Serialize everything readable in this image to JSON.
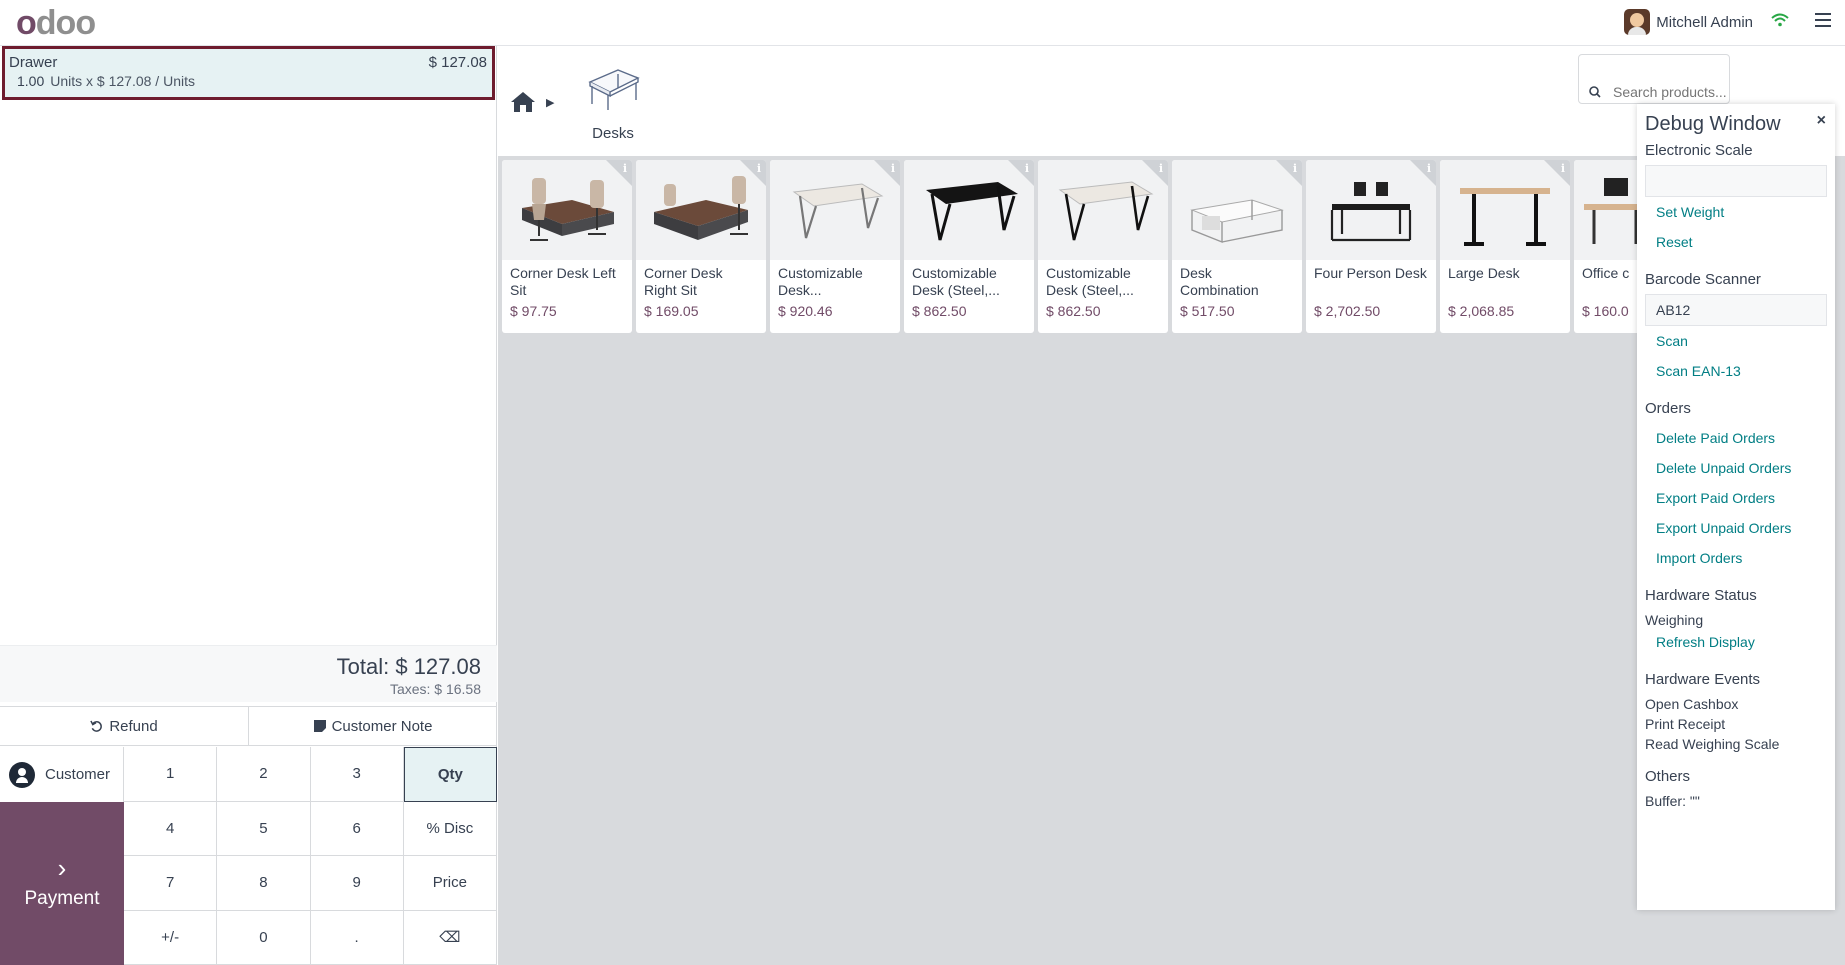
{
  "header": {
    "logo": "odoo",
    "user_name": "Mitchell Admin"
  },
  "order": {
    "line": {
      "product": "Drawer",
      "price": "$ 127.08",
      "qty": "1.00",
      "detail": "Units x $ 127.08 / Units"
    },
    "total": "Total: $ 127.08",
    "taxes": "Taxes: $ 16.58"
  },
  "actions": {
    "refund": "Refund",
    "customer_note": "Customer Note",
    "customer": "Customer",
    "payment": "Payment"
  },
  "numpad": [
    "1",
    "2",
    "3",
    "Qty",
    "4",
    "5",
    "6",
    "% Disc",
    "7",
    "8",
    "9",
    "Price",
    "+/-",
    "0",
    ".",
    "⌫"
  ],
  "categories": {
    "current": "Desks"
  },
  "search": {
    "placeholder": "Search products..."
  },
  "products": [
    {
      "name": "Corner Desk Left Sit",
      "price": "$ 97.75"
    },
    {
      "name": "Corner Desk Right Sit",
      "price": "$ 169.05"
    },
    {
      "name": "Customizable Desk...",
      "price": "$ 920.46"
    },
    {
      "name": "Customizable Desk (Steel,...",
      "price": "$ 862.50"
    },
    {
      "name": "Customizable Desk (Steel,...",
      "price": "$ 862.50"
    },
    {
      "name": "Desk Combination",
      "price": "$ 517.50"
    },
    {
      "name": "Four Person Desk",
      "price": "$ 2,702.50"
    },
    {
      "name": "Large Desk",
      "price": "$ 2,068.85"
    },
    {
      "name": "Office c",
      "price": "$ 160.0"
    }
  ],
  "debug": {
    "title": "Debug Window",
    "close": "×",
    "scale_title": "Electronic Scale",
    "set_weight": "Set Weight",
    "reset": "Reset",
    "barcode_title": "Barcode Scanner",
    "barcode_value": "AB12",
    "scan": "Scan",
    "scan_ean": "Scan EAN-13",
    "orders_title": "Orders",
    "delete_paid": "Delete Paid Orders",
    "delete_unpaid": "Delete Unpaid Orders",
    "export_paid": "Export Paid Orders",
    "export_unpaid": "Export Unpaid Orders",
    "import_orders": "Import Orders",
    "hw_status_title": "Hardware Status",
    "weighing": "Weighing",
    "refresh_display": "Refresh Display",
    "hw_events_title": "Hardware Events",
    "open_cashbox": "Open Cashbox",
    "print_receipt": "Print Receipt",
    "read_scale": "Read Weighing Scale",
    "others_title": "Others",
    "buffer": "Buffer: \"\""
  },
  "colors": {
    "brand": "#714b67",
    "link": "#017e84",
    "selected_line_border": "#6e1c2e",
    "selected_bg": "#e6f2f3"
  }
}
